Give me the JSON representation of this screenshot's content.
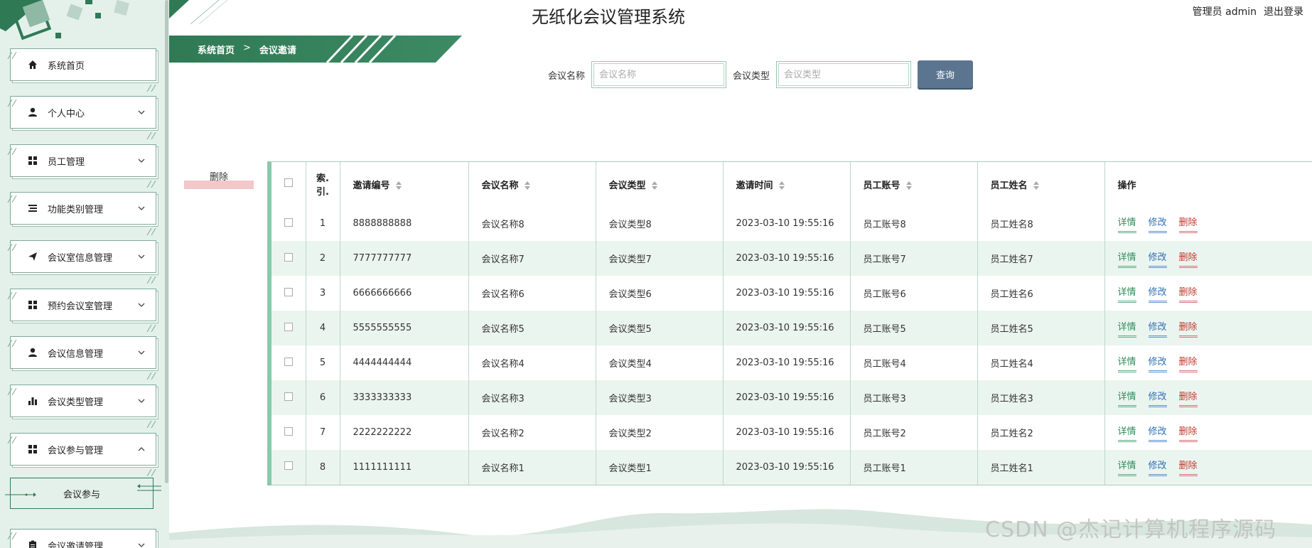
{
  "app": {
    "title": "无纸化会议管理系统"
  },
  "user": {
    "name": "管理员 admin",
    "logout_label": "退出登录"
  },
  "breadcrumb": {
    "home": "系统首页",
    "separator": ">",
    "current": "会议邀请"
  },
  "sidebar": {
    "items": [
      {
        "label": "系统首页",
        "icon": "home-icon"
      },
      {
        "label": "个人中心",
        "icon": "user-icon"
      },
      {
        "label": "员工管理",
        "icon": "grid-icon"
      },
      {
        "label": "功能类别管理",
        "icon": "list-icon"
      },
      {
        "label": "会议室信息管理",
        "icon": "send-icon"
      },
      {
        "label": "预约会议室管理",
        "icon": "grid-icon"
      },
      {
        "label": "会议信息管理",
        "icon": "user-icon"
      },
      {
        "label": "会议类型管理",
        "icon": "bar-chart-icon"
      },
      {
        "label": "会议参与管理",
        "icon": "grid-icon"
      },
      {
        "label": "会议邀请管理",
        "icon": "clipboard-icon"
      }
    ],
    "submenu": {
      "label": "会议参与"
    }
  },
  "search": {
    "name_label": "会议名称",
    "name_placeholder": "会议名称",
    "name_value": "",
    "type_label": "会议类型",
    "type_placeholder": "会议类型",
    "type_value": "",
    "button_label": "查询"
  },
  "batch_delete_label": "删除",
  "table": {
    "headers": {
      "index_line1": "索.",
      "index_line2": "引.",
      "invite_no": "邀请编号",
      "meeting_name": "会议名称",
      "meeting_type": "会议类型",
      "invite_time": "邀请时间",
      "emp_account": "员工账号",
      "emp_name": "员工姓名",
      "actions": "操作"
    },
    "action_labels": {
      "detail": "详情",
      "edit": "修改",
      "delete": "删除"
    },
    "rows": [
      {
        "idx": "1",
        "invite_no": "8888888888",
        "meeting_name": "会议名称8",
        "meeting_type": "会议类型8",
        "invite_time": "2023-03-10 19:55:16",
        "emp_account": "员工账号8",
        "emp_name": "员工姓名8"
      },
      {
        "idx": "2",
        "invite_no": "7777777777",
        "meeting_name": "会议名称7",
        "meeting_type": "会议类型7",
        "invite_time": "2023-03-10 19:55:16",
        "emp_account": "员工账号7",
        "emp_name": "员工姓名7"
      },
      {
        "idx": "3",
        "invite_no": "6666666666",
        "meeting_name": "会议名称6",
        "meeting_type": "会议类型6",
        "invite_time": "2023-03-10 19:55:16",
        "emp_account": "员工账号6",
        "emp_name": "员工姓名6"
      },
      {
        "idx": "4",
        "invite_no": "5555555555",
        "meeting_name": "会议名称5",
        "meeting_type": "会议类型5",
        "invite_time": "2023-03-10 19:55:16",
        "emp_account": "员工账号5",
        "emp_name": "员工姓名5"
      },
      {
        "idx": "5",
        "invite_no": "4444444444",
        "meeting_name": "会议名称4",
        "meeting_type": "会议类型4",
        "invite_time": "2023-03-10 19:55:16",
        "emp_account": "员工账号4",
        "emp_name": "员工姓名4"
      },
      {
        "idx": "6",
        "invite_no": "3333333333",
        "meeting_name": "会议名称3",
        "meeting_type": "会议类型3",
        "invite_time": "2023-03-10 19:55:16",
        "emp_account": "员工账号3",
        "emp_name": "员工姓名3"
      },
      {
        "idx": "7",
        "invite_no": "2222222222",
        "meeting_name": "会议名称2",
        "meeting_type": "会议类型2",
        "invite_time": "2023-03-10 19:55:16",
        "emp_account": "员工账号2",
        "emp_name": "员工姓名2"
      },
      {
        "idx": "8",
        "invite_no": "1111111111",
        "meeting_name": "会议名称1",
        "meeting_type": "会议类型1",
        "invite_time": "2023-03-10 19:55:16",
        "emp_account": "员工账号1",
        "emp_name": "员工姓名1"
      }
    ]
  },
  "watermark": "CSDN @杰记计算机程序源码",
  "colors": {
    "primary_green": "#2f7a55",
    "sidebar_bg": "#e4f1eb",
    "search_button": "#5b7590",
    "detail_link": "#2e8b57",
    "edit_link": "#2f6fb5",
    "delete_link": "#c0392b"
  }
}
